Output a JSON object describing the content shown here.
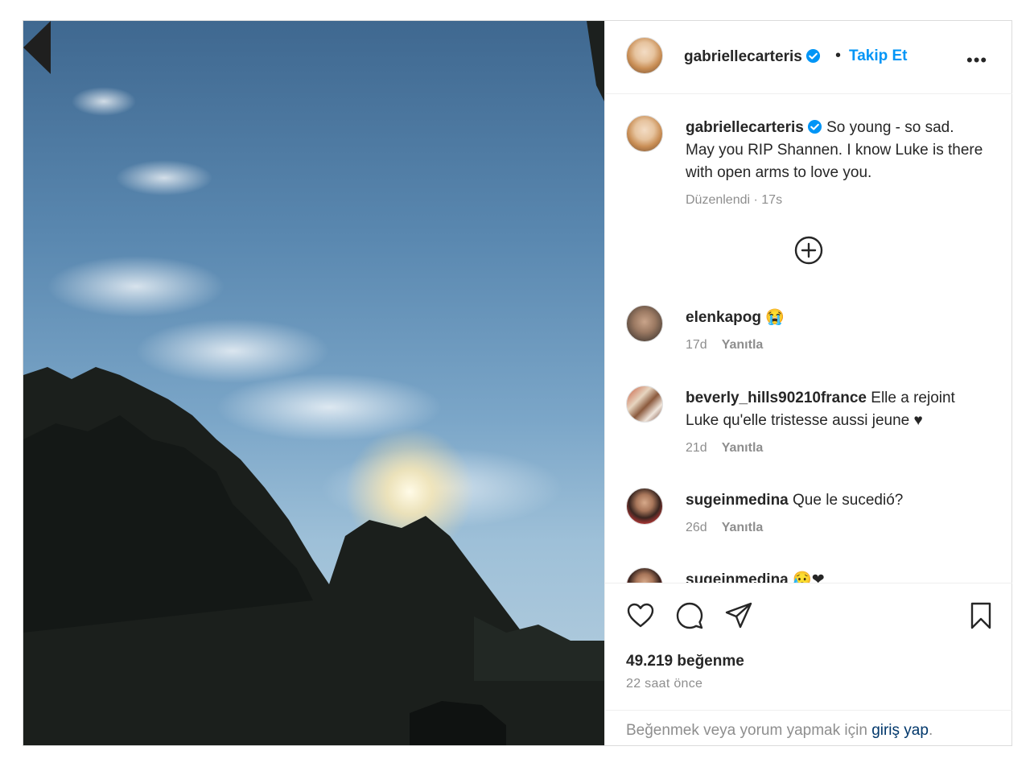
{
  "post": {
    "author": "gabriellecarteris",
    "follow_label": "Takip Et",
    "header_separator": "•",
    "more_label": "•••",
    "caption_text": "So young - so sad. May you RIP Shannen. I know Luke is there with open arms to love you.",
    "caption_meta": "Düzenlendi · 17s"
  },
  "comments": [
    {
      "user": "elenkapog",
      "text": "😭",
      "age": "17d",
      "reply": "Yanıtla"
    },
    {
      "user": "beverly_hills90210france",
      "text": "Elle a rejoint Luke qu'elle tristesse aussi jeune ♥",
      "age": "21d",
      "reply": "Yanıtla"
    },
    {
      "user": "sugeinmedina",
      "text": "Que le sucedió?",
      "age": "26d",
      "reply": "Yanıtla"
    },
    {
      "user": "sugeinmedina",
      "text": "😥❤"
    }
  ],
  "footer": {
    "likes": "49.219 beğenme",
    "time_ago": "22 saat önce",
    "login_prefix": "Beğenmek veya yorum yapmak için ",
    "login_link": "giriş yap",
    "login_suffix": "."
  },
  "colors": {
    "link_blue": "#0095f6",
    "verified_blue": "#0095f6",
    "muted_text": "#8e8e8e",
    "border": "#dbdbdb"
  },
  "icons": {
    "verified": "verified-badge-icon",
    "like": "heart-outline-icon",
    "comment": "speech-bubble-icon",
    "share": "paper-plane-icon",
    "save": "bookmark-icon",
    "load_more": "plus-circle-icon",
    "previous": "chevron-left-icon"
  }
}
